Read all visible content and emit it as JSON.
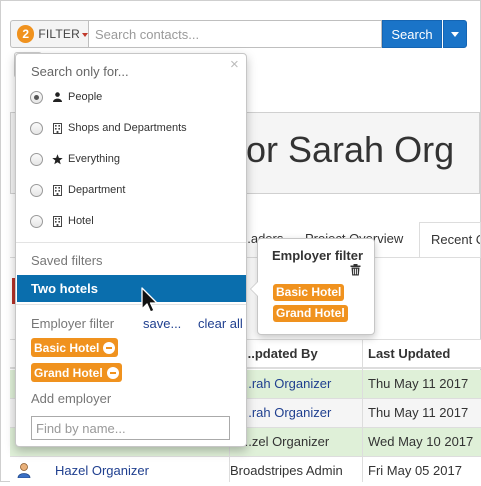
{
  "search_bar": {
    "filter_count": "2",
    "filter_label": "FILTER",
    "placeholder": "Search contacts...",
    "search_button": "Search"
  },
  "page": {
    "title": "for Sarah Org",
    "tabs": [
      {
        "label": "...aders"
      },
      {
        "label": "Project Overview"
      },
      {
        "label": "Recent C"
      }
    ],
    "table": {
      "headers": [
        "...pdated By",
        "Last Updated"
      ],
      "rows": [
        {
          "updated_by": "...rah Organizer",
          "last_updated": "Thu May 11 2017"
        },
        {
          "updated_by": "...rah Organizer",
          "last_updated": "Thu May 11 2017"
        },
        {
          "updated_by": "...zel Organizer",
          "last_updated": "Wed May 10 2017"
        },
        {
          "name": "Hazel Organizer",
          "updated_by": "Broadstripes Admin",
          "last_updated": "Fri May 05 2017"
        }
      ]
    }
  },
  "filter_panel": {
    "close_symbol": "×",
    "header": "Search only for...",
    "options": [
      {
        "label": "People",
        "icon": "person-icon",
        "selected": true
      },
      {
        "label": "Shops and Departments",
        "icon": "building-icon",
        "selected": false
      },
      {
        "label": "Everything",
        "icon": "star-icon",
        "selected": false
      },
      {
        "label": "Department",
        "icon": "building-icon",
        "selected": false
      },
      {
        "label": "Hotel",
        "icon": "building-icon",
        "selected": false
      }
    ],
    "saved_filters_label": "Saved filters",
    "saved_filters": [
      {
        "label": "Two hotels",
        "highlighted": true
      }
    ],
    "employer_filter_label": "Employer filter",
    "save_link": "save...",
    "clear_link": "clear all",
    "employer_tags": [
      "Basic Hotel",
      "Grand Hotel"
    ],
    "add_employer_label": "Add employer",
    "find_placeholder": "Find by name..."
  },
  "popover": {
    "title": "Employer filter",
    "tags": [
      "Basic Hotel",
      "Grand Hotel"
    ]
  },
  "colors": {
    "accent_orange": "#f0921e",
    "primary_blue": "#1a74c8",
    "selected_blue": "#0a6ead",
    "row_green": "#dff0d8"
  }
}
